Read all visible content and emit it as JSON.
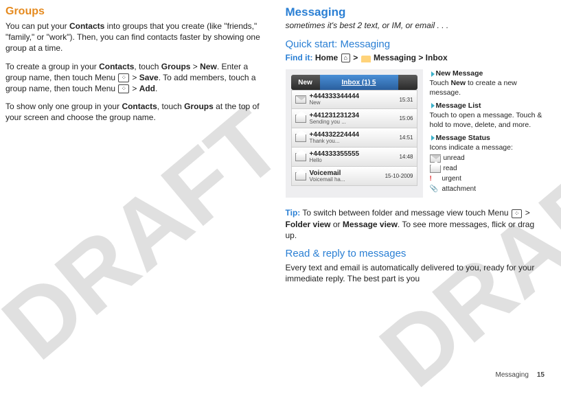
{
  "watermark": "DRAFT",
  "left": {
    "heading": "Groups",
    "p1a": "You can put your ",
    "p1b": "Contacts",
    "p1c": " into groups that you create (like \"friends,\" \"family,\" or \"work\"). Then, you can find contacts faster by showing one group at a time.",
    "p2a": "To create a group in your ",
    "p2b": "Contacts",
    "p2c": ", touch ",
    "p2d": "Groups",
    "p2e": " > ",
    "p2f": "New",
    "p2g": ". Enter a group name, then touch Menu ",
    "p2h": " > ",
    "p2i": "Save",
    "p2j": ". To add members, touch a group name, then touch Menu ",
    "p2k": " > ",
    "p2l": "Add",
    "p2m": ".",
    "p3a": "To show only one group in your ",
    "p3b": "Contacts",
    "p3c": ", touch ",
    "p3d": "Groups",
    "p3e": " at the top of your screen and choose the group name."
  },
  "right": {
    "heading": "Messaging",
    "subtitle": "sometimes it's best 2 text, or IM, or email . . .",
    "quick": "Quick start: Messaging",
    "findit": "Find it:",
    "find_home": " Home ",
    "find_gt": " > ",
    "find_msg": " Messaging",
    "find_inbox": "Inbox",
    "phone": {
      "newtab": "New",
      "inboxtab": "Inbox (1) 5",
      "rows": [
        {
          "num": "+444333344444",
          "prev": "New",
          "time": "15:31",
          "open": false
        },
        {
          "num": "+441231231234",
          "prev": "Sending you ...",
          "time": "15:06",
          "open": true
        },
        {
          "num": "+444332224444",
          "prev": "Thank you...",
          "time": "14:51",
          "open": true
        },
        {
          "num": "+444333355555",
          "prev": "Hello",
          "time": "14:48",
          "open": true
        },
        {
          "num": "Voicemail",
          "prev": "Voicemail ha...",
          "time": "15-10-2009",
          "open": true
        }
      ]
    },
    "annot": {
      "nm_h": "New Message",
      "nm_t": "Touch New to create a new message.",
      "ml_h": "Message List",
      "ml_t": "Touch to open a message. Touch & hold to move, delete, and more.",
      "ms_h": "Message Status",
      "ms_t": "Icons indicate a message:",
      "unread": "unread",
      "read": "read",
      "urgent": "urgent",
      "attach": "attachment"
    },
    "tip_label": "Tip:",
    "tip_text_a": " To switch between folder and message view touch Menu ",
    "tip_text_b": " > ",
    "tip_fv": "Folder view",
    "tip_or": " or ",
    "tip_mv": "Message view",
    "tip_text_c": ". To see more messages, flick or drag up.",
    "read_h": "Read & reply to messages",
    "read_p": "Every text and email is automatically delivered to you, ready for your immediate reply. The best part is you"
  },
  "footer": {
    "section": "Messaging",
    "page": "15"
  }
}
